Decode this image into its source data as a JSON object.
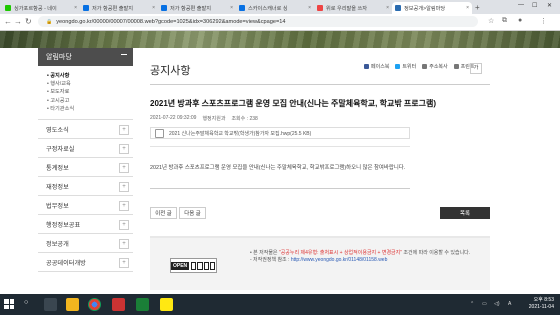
{
  "browser": {
    "tabs": [
      {
        "title": "싱가포르항공 - 네이"
      },
      {
        "title": "저가 항공편 출발지"
      },
      {
        "title": "저가 항공편 출발지"
      },
      {
        "title": "스카이스캐너로 싱"
      },
      {
        "title": "위로 우리말을 쓰자"
      },
      {
        "title": "정보공개>알림마당"
      }
    ],
    "url": "yeongdo.go.kr/00000/00007/00008.web?gcode=1025&idx=306292&amode=view&cpage=14"
  },
  "sidebar": {
    "header": "알림마당",
    "subitems": [
      "공지사항",
      "행사/교육",
      "보도자료",
      "고시공고",
      "타기관소식"
    ],
    "categories": [
      "영도소식",
      "구정자료실",
      "통계정보",
      "재정정보",
      "법무정보",
      "행정정보공표",
      "정보공개",
      "공공데이터개방"
    ]
  },
  "main": {
    "page_title": "공지사항",
    "share": {
      "facebook": "페이스북",
      "twitter": "트위터",
      "copy": "주소복사",
      "print": "프린트"
    },
    "zoom": "가",
    "article_title": "2021년 방과후 스포츠프로그램 운영 모집 안내(신나는 주말체육학교, 학교밖 프로그램)",
    "date": "2021-07-22 09:32:09",
    "dept": "행정지원과",
    "views_label": "조회수",
    "views": "238",
    "attachment": "2021 신나는주말체육학교 학교밖(학생가)참가자 모집.hwp(25.5 KB)",
    "body": "2021년 방과후 스포츠프로그램 운영 모집을 안내(신나는 주말체육학교, 학교밖프로그램)하오니 많은 참여바랍니다.",
    "prev_btn": "이전 글",
    "next_btn": "다음 글",
    "list_btn": "목록",
    "license": {
      "ccl_open": "OPEN",
      "line1_pre": "본 저작물은 ",
      "line1_red": "\"공공누리 제4유형: 출처표시 + 상업적이용금지 + 변경금지\"",
      "line1_post": " 조건에 따라 이용할 수 있습니다.",
      "line2_pre": "- 저작권정책 참조 : ",
      "line2_link": "http://www.yeongdo.go.kr/01148/01158.web"
    }
  },
  "taskbar": {
    "time": "오후 8:53",
    "date": "2021-11-04"
  },
  "colors": {
    "sidebar_header": "#4d4d4d",
    "list_button": "#333333",
    "taskbar": "#1f2a33"
  }
}
